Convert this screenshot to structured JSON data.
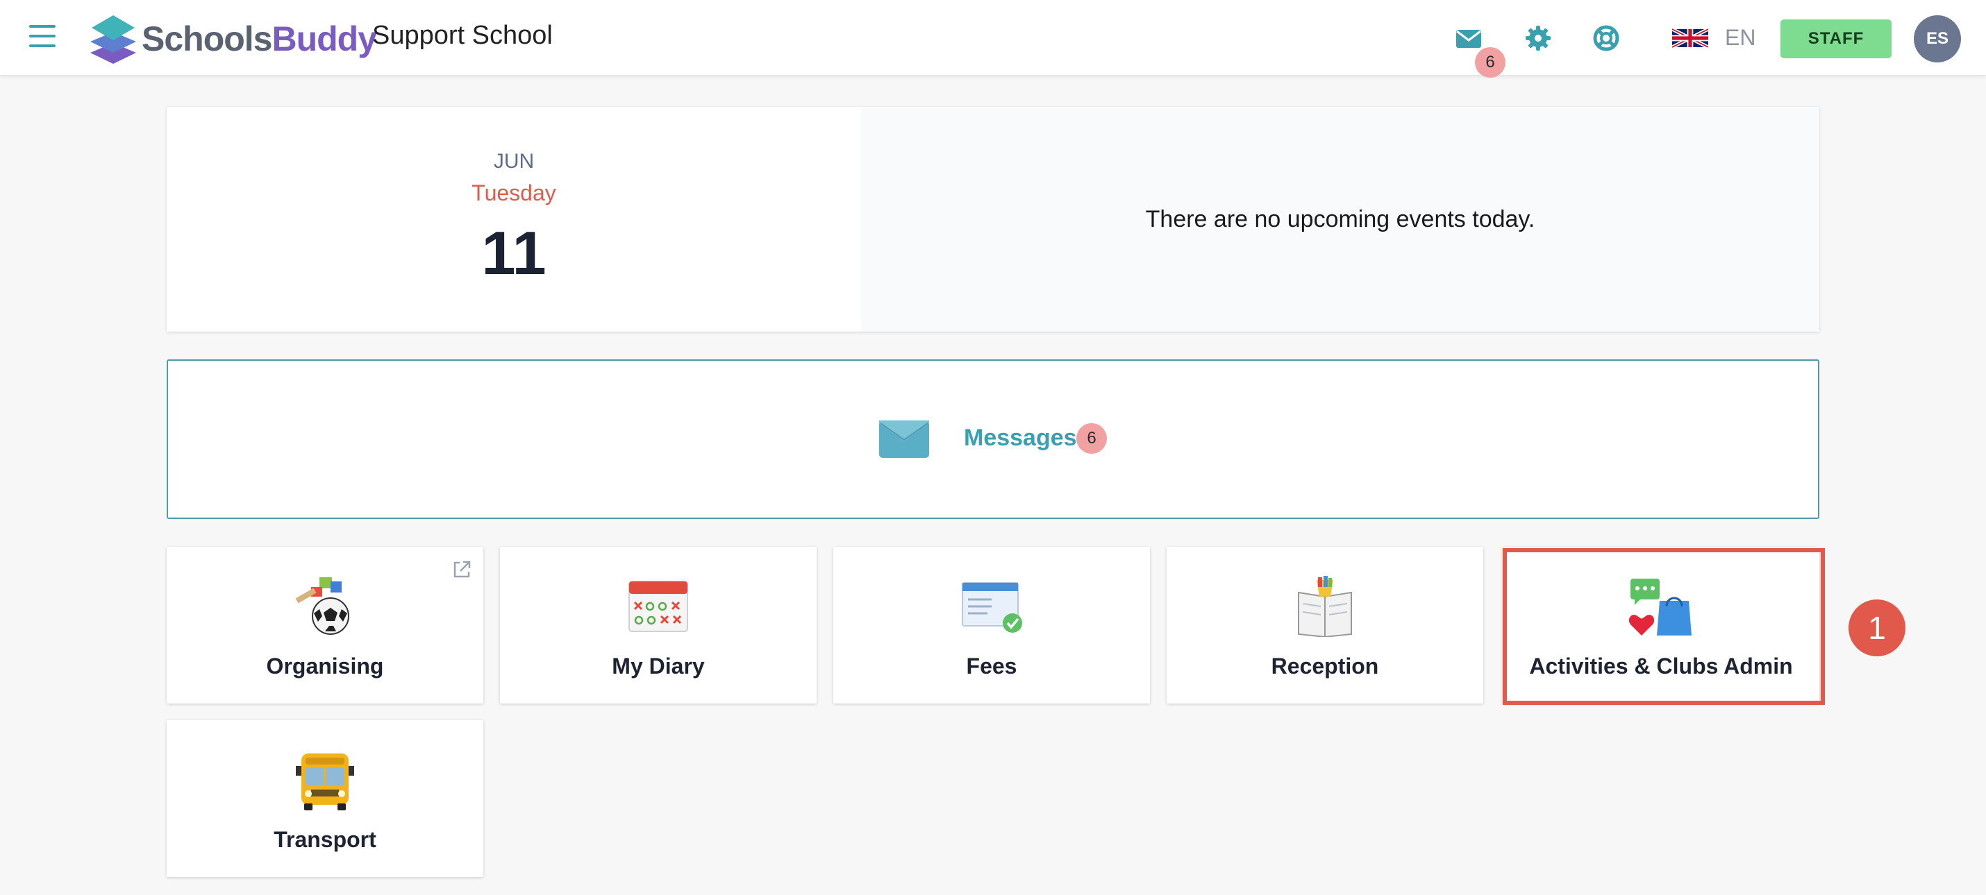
{
  "header": {
    "logo": {
      "part1": "Schools",
      "part2": "Buddy"
    },
    "school_name": "Support School",
    "mail_badge": "6",
    "language": {
      "code": "EN",
      "flag": "uk-flag-icon"
    },
    "staff_button": "STAFF",
    "avatar_initials": "ES",
    "icons": [
      "menu-icon",
      "envelope-icon",
      "gear-icon",
      "lifebuoy-icon"
    ]
  },
  "date_card": {
    "month": "JUN",
    "weekday": "Tuesday",
    "day": "11",
    "events_message": "There are no upcoming events today."
  },
  "messages": {
    "label": "Messages",
    "count": "6"
  },
  "tiles": [
    {
      "label": "Organising",
      "icon": "organising-icon"
    },
    {
      "label": "My Diary",
      "icon": "calendar-icon"
    },
    {
      "label": "Fees",
      "icon": "fees-check-icon"
    },
    {
      "label": "Reception",
      "icon": "reception-book-icon"
    },
    {
      "label": "Activities & Clubs Admin",
      "icon": "activities-bag-icon"
    },
    {
      "label": "Transport",
      "icon": "school-bus-icon"
    }
  ],
  "annotation": {
    "step": "1"
  },
  "colors": {
    "accent": "#3aa0ae",
    "brand_purple": "#7a5cc0",
    "staff_green": "#7ddc8f",
    "badge_pink": "#f2a1a3",
    "highlight_red": "#e0594b",
    "weekday_red": "#e05a4e"
  }
}
